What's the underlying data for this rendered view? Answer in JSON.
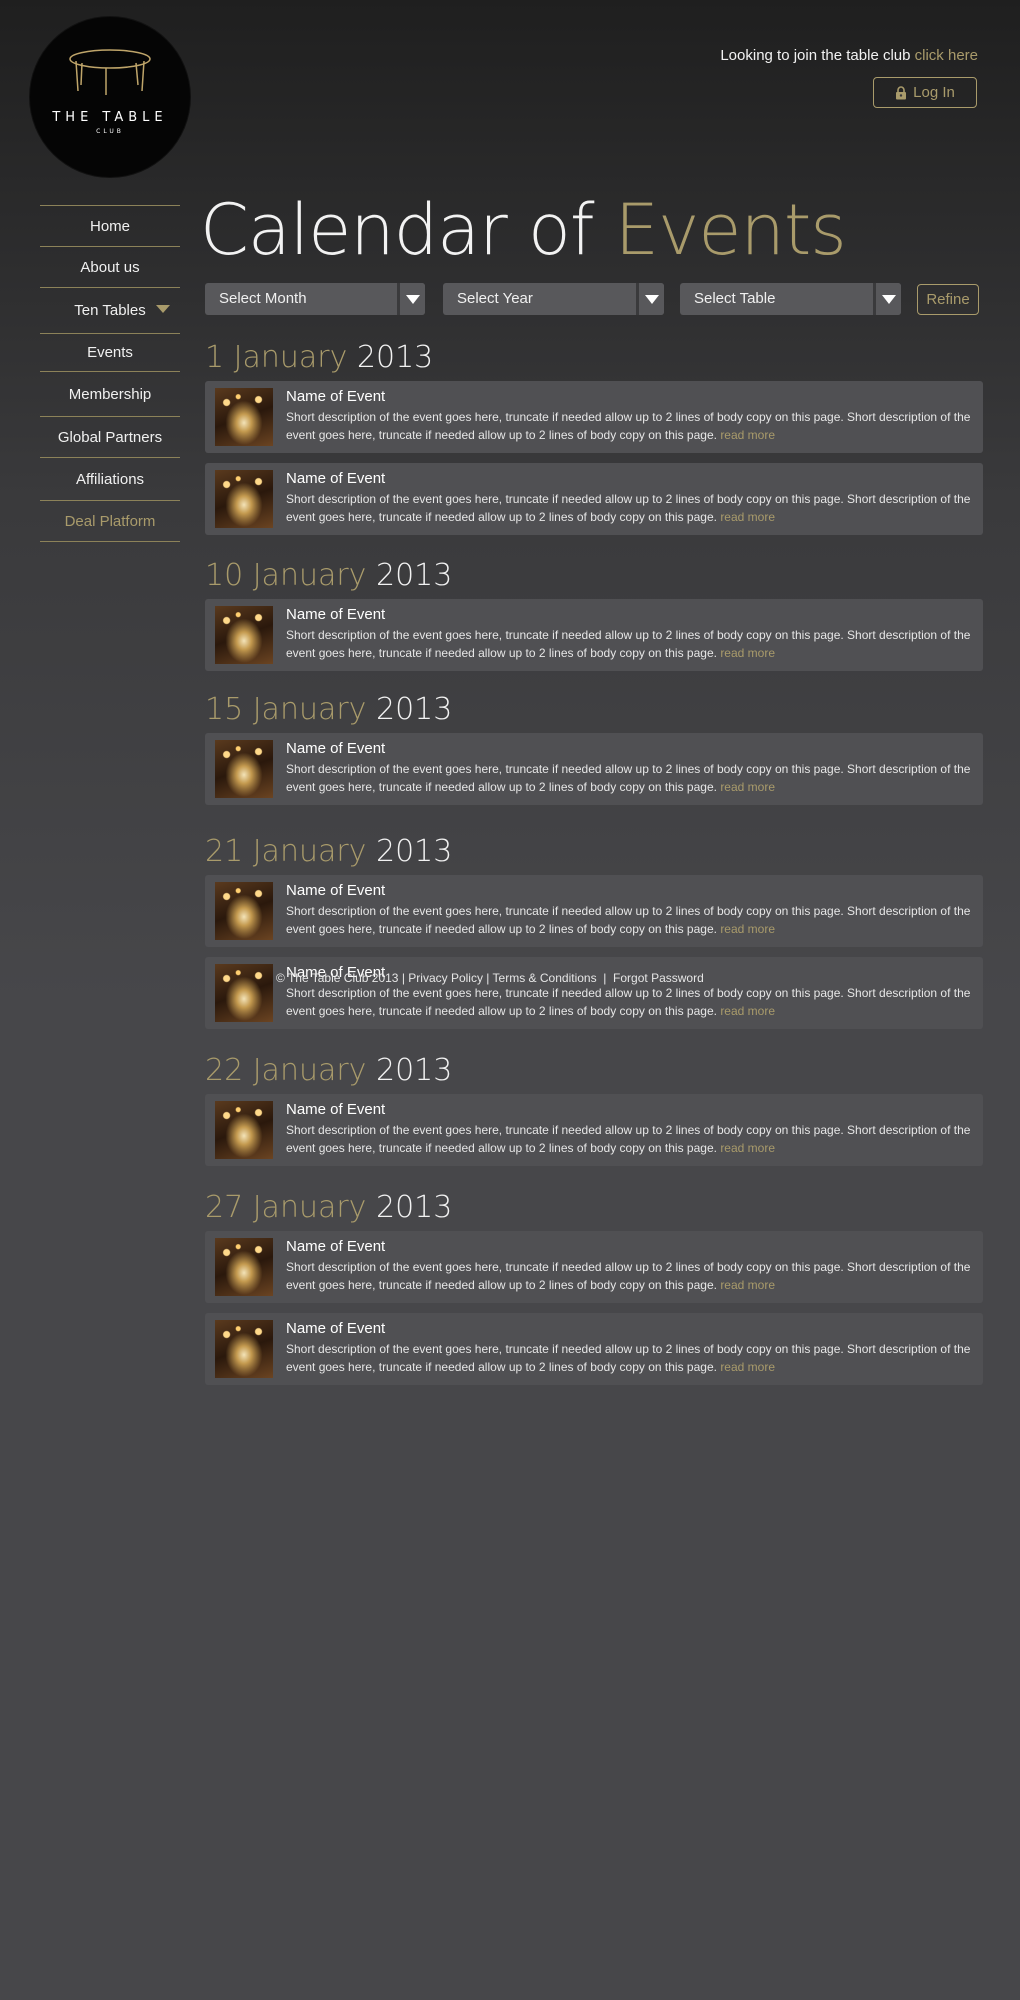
{
  "brand": {
    "name": "THE TABLE",
    "sub": "CLUB"
  },
  "header": {
    "join_text": "Looking to join the table club",
    "join_link": "click here",
    "login_label": "Log In"
  },
  "sidebar": {
    "items": [
      {
        "label": "Home"
      },
      {
        "label": "About us"
      },
      {
        "label": "Ten Tables"
      },
      {
        "label": "Events"
      },
      {
        "label": "Membership"
      },
      {
        "label": "Global Partners"
      },
      {
        "label": "Affiliations"
      },
      {
        "label": "Deal Platform"
      }
    ]
  },
  "title": {
    "part1": "Calendar of",
    "part2": "Events"
  },
  "filters": {
    "month": "Select Month",
    "year": "Select Year",
    "table": "Select Table",
    "refine": "Refine"
  },
  "event_text": {
    "name": "Name of Event",
    "desc": "Short description of the event goes here, truncate if needed allow up to 2 lines of body copy on this page. Short description of the event goes here, truncate if needed allow up to 2 lines of body copy on this page.",
    "more": "read more"
  },
  "groups": [
    {
      "day_month": "1 January",
      "year": "2013",
      "count": 2
    },
    {
      "day_month": "10 January",
      "year": "2013",
      "count": 1
    },
    {
      "day_month": "15 January",
      "year": "2013",
      "count": 1
    },
    {
      "day_month": "21 January",
      "year": "2013",
      "count": 2
    },
    {
      "day_month": "22 January",
      "year": "2013",
      "count": 1
    },
    {
      "day_month": "27 January",
      "year": "2013",
      "count": 2
    }
  ],
  "footer": {
    "copyright": "© The Table Club 2013",
    "privacy": "Privacy Policy",
    "terms": "Terms & Conditions",
    "forgot": "Forgot Password"
  },
  "colors": {
    "accent": "#a99b6b",
    "card": "#505053",
    "background": "#47474a"
  }
}
